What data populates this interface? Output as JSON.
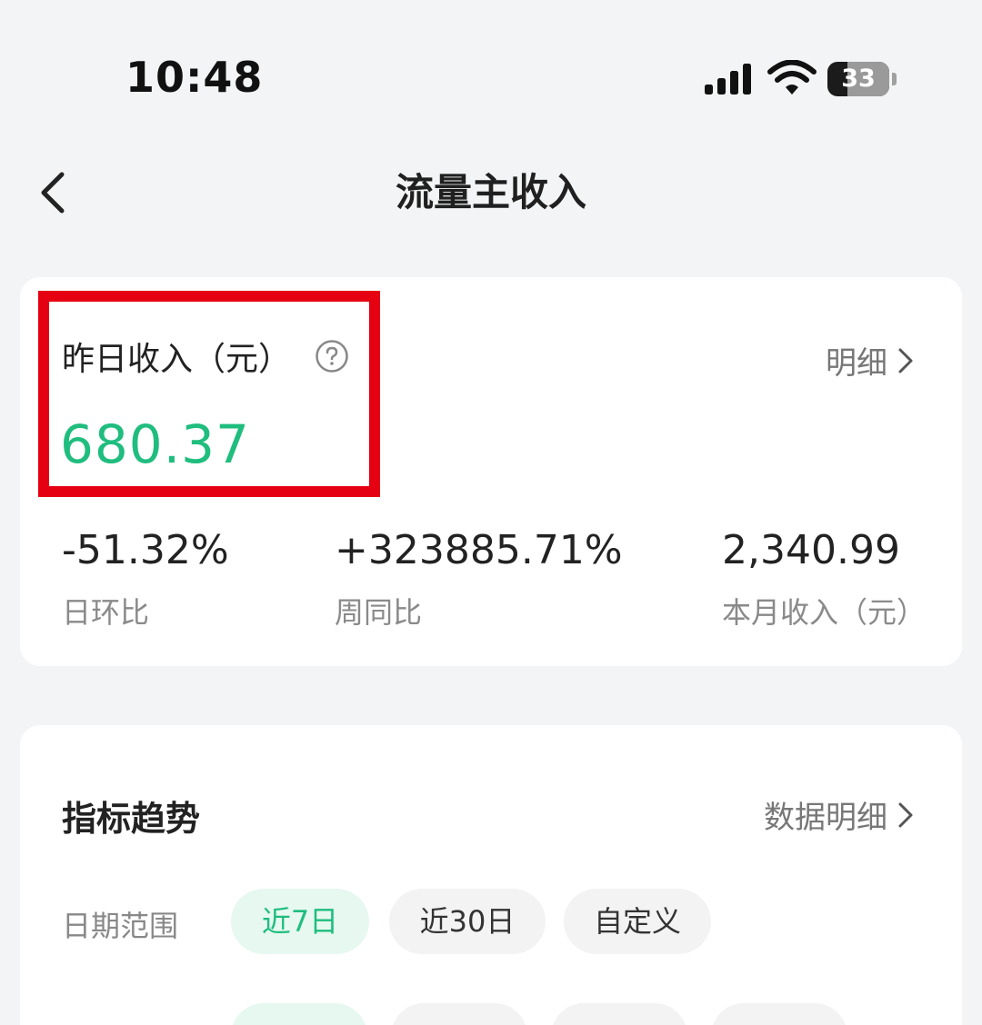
{
  "status_bar": {
    "time": "10:48",
    "battery": "33"
  },
  "nav": {
    "title": "流量主收入"
  },
  "income_card": {
    "label": "昨日收入（元）",
    "value": "680.37",
    "detail_link": "明细",
    "stats": [
      {
        "value": "-51.32%",
        "label": "日环比"
      },
      {
        "value": "+323885.71%",
        "label": "周同比"
      },
      {
        "value": "2,340.99",
        "label": "本月收入（元）"
      }
    ]
  },
  "trend_card": {
    "title": "指标趋势",
    "detail_link": "数据明细",
    "date_range_label": "日期范围",
    "date_options": [
      "近7日",
      "近30日",
      "自定义"
    ],
    "selected_date_option": "近7日"
  },
  "colors": {
    "accent": "#1fbd7e",
    "highlight": "#e50012",
    "background": "#f3f4f5"
  }
}
